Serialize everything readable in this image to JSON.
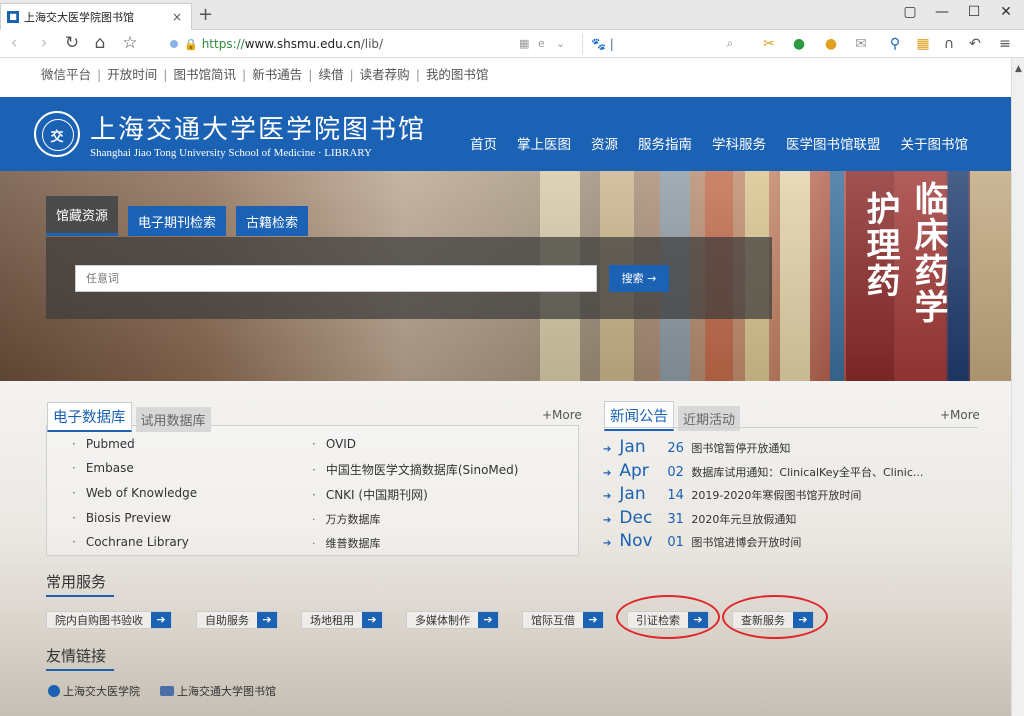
{
  "browser": {
    "tab_title": "上海交大医学院图书馆",
    "tab_close": "×",
    "new_tab": "+",
    "url_protocol": "https://",
    "url_host": "www.shsmu.edu.cn",
    "url_path": "/lib/",
    "window_controls": [
      "▢",
      "—",
      "☐",
      "✕"
    ]
  },
  "top_links": [
    "微信平台",
    "开放时间",
    "图书馆简讯",
    "新书通告",
    "续借",
    "读者荐购",
    "我的图书馆"
  ],
  "header": {
    "logo_cn": "上海交通大学医学院图书馆",
    "logo_en": "Shanghai Jiao Tong University School of Medicine · LIBRARY",
    "nav": [
      "首页",
      "掌上医图",
      "资源",
      "服务指南",
      "学科服务",
      "医学图书馆联盟",
      "关于图书馆"
    ]
  },
  "search": {
    "tabs": [
      "馆藏资源",
      "电子期刊检索",
      "古籍检索"
    ],
    "placeholder": "任意词",
    "button": "搜索 →"
  },
  "databases": {
    "tabs": [
      "电子数据库",
      "试用数据库"
    ],
    "more": "+More",
    "col1": [
      "Pubmed",
      "Embase",
      "Web of Knowledge",
      "Biosis Preview",
      "Cochrane Library"
    ],
    "col2": [
      "OVID",
      "中国生物医学文摘数据库(SinoMed)",
      "CNKI (中国期刊网)",
      "万方数据库",
      "维普数据库"
    ]
  },
  "news": {
    "tabs": [
      "新闻公告",
      "近期活动"
    ],
    "more": "+More",
    "items": [
      {
        "month": "Jan",
        "day": "26",
        "text": "图书馆暂停开放通知"
      },
      {
        "month": "Apr",
        "day": "02",
        "text": "数据库试用通知：ClinicalKey全平台、Clinic..."
      },
      {
        "month": "Jan",
        "day": "14",
        "text": "2019-2020年寒假图书馆开放时间"
      },
      {
        "month": "Dec",
        "day": "31",
        "text": "2020年元旦放假通知"
      },
      {
        "month": "Nov",
        "day": "01",
        "text": "图书馆进博会开放时间"
      }
    ]
  },
  "services": {
    "title": "常用服务",
    "items": [
      "院内自购图书验收",
      "自助服务",
      "场地租用",
      "多媒体制作",
      "馆际互借",
      "引证检索",
      "查新服务"
    ],
    "arrow": "➔",
    "highlight_color": "#e0262a"
  },
  "friends": {
    "title": "友情链接",
    "items": [
      "上海交大医学院",
      "上海交通大学图书馆"
    ]
  },
  "colors": {
    "brand_blue": "#1b62b4"
  }
}
